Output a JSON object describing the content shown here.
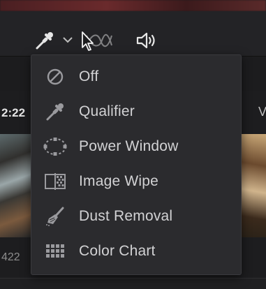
{
  "toolbar": {
    "picker_icon": "color-picker-icon",
    "chevron_icon": "chevron-down-icon",
    "scopes_icon": "scopes-icon",
    "audio_icon": "speaker-icon"
  },
  "background": {
    "timecode_left": "2:22",
    "number_left": "422",
    "letter_right": "V"
  },
  "menu": {
    "items": [
      {
        "label": "Off",
        "icon": "off-icon"
      },
      {
        "label": "Qualifier",
        "icon": "qualifier-picker-icon"
      },
      {
        "label": "Power Window",
        "icon": "power-window-icon"
      },
      {
        "label": "Image Wipe",
        "icon": "image-wipe-icon"
      },
      {
        "label": "Dust Removal",
        "icon": "dust-removal-brush-icon"
      },
      {
        "label": "Color Chart",
        "icon": "color-chart-grid-icon"
      }
    ]
  },
  "colors": {
    "menu_bg": "#2b2b2e",
    "text": "#d2d2d4",
    "icon": "#9a9a9e"
  }
}
